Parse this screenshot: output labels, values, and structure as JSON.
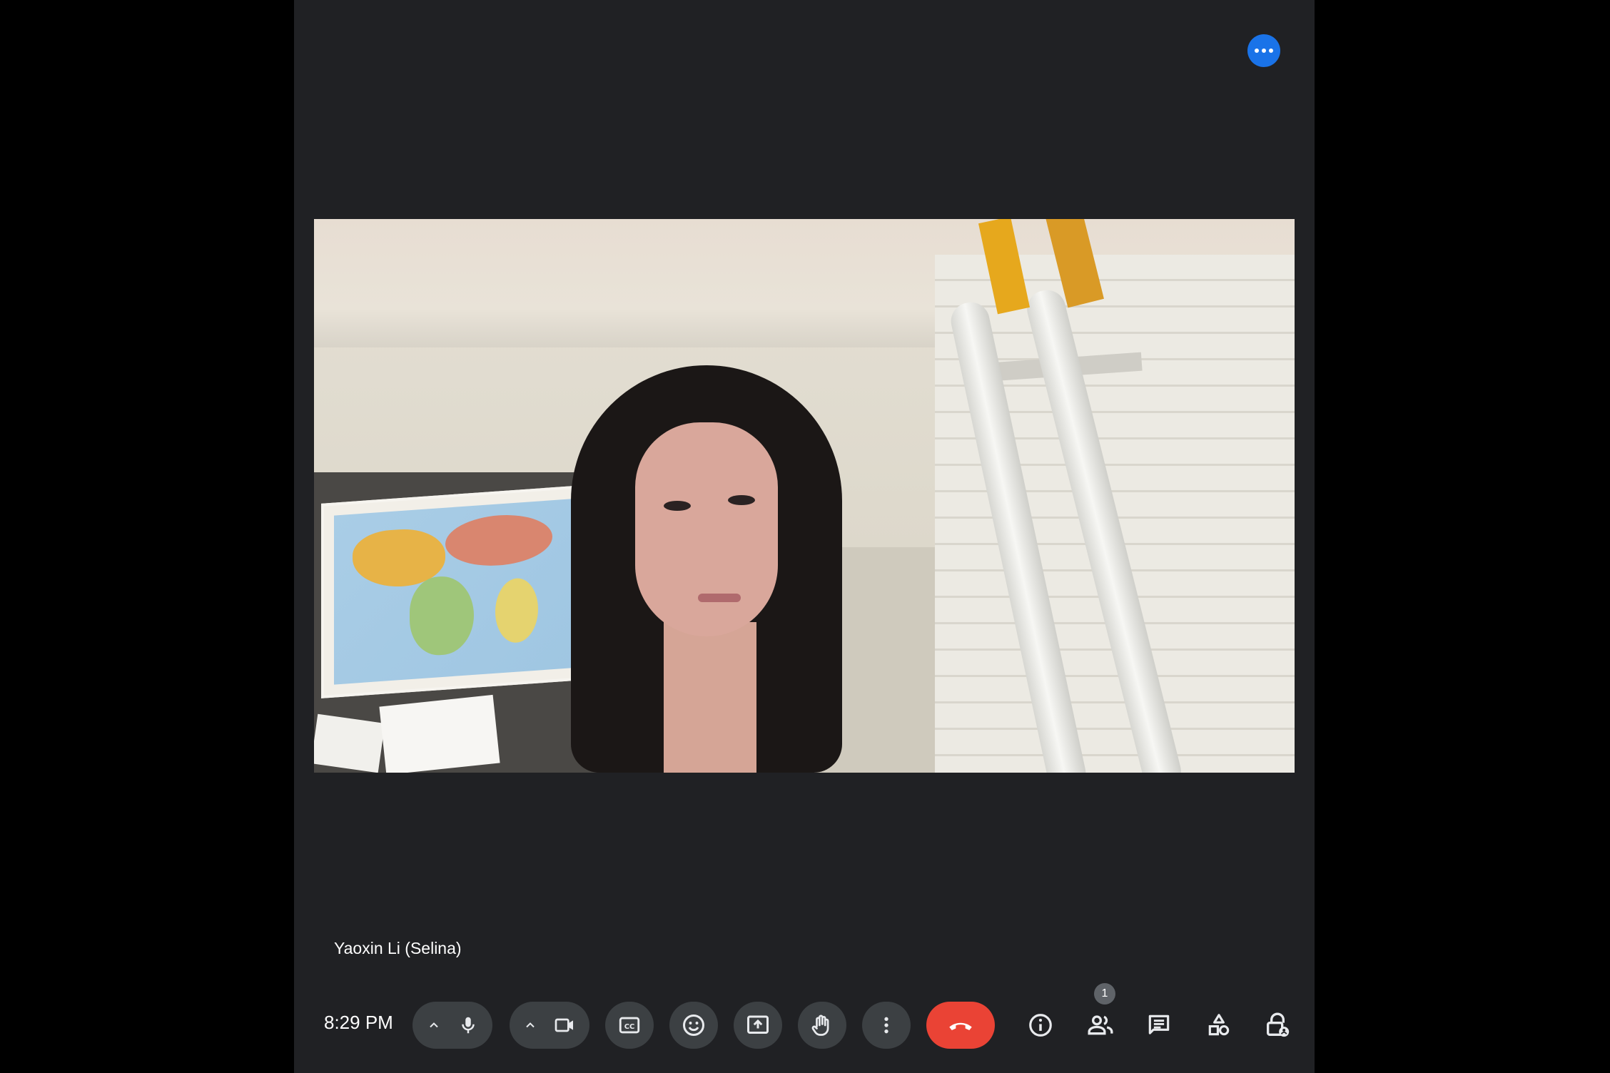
{
  "participant": {
    "name": "Yaoxin Li (Selina)"
  },
  "toolbar": {
    "time": "8:29 PM",
    "people_count": "1"
  },
  "icons": {
    "more": "more-horizontal-icon",
    "mic": "microphone-icon",
    "camera": "camera-icon",
    "captions": "captions-icon",
    "emoji": "emoji-icon",
    "present": "present-screen-icon",
    "hand": "raise-hand-icon",
    "more_options": "more-vertical-icon",
    "end_call": "end-call-icon",
    "info": "info-icon",
    "people": "people-icon",
    "chat": "chat-icon",
    "activities": "activities-icon",
    "host_controls": "host-controls-icon"
  },
  "colors": {
    "background": "#202124",
    "button": "#3c4043",
    "end_call": "#ea4335",
    "accent": "#1a73e8"
  }
}
